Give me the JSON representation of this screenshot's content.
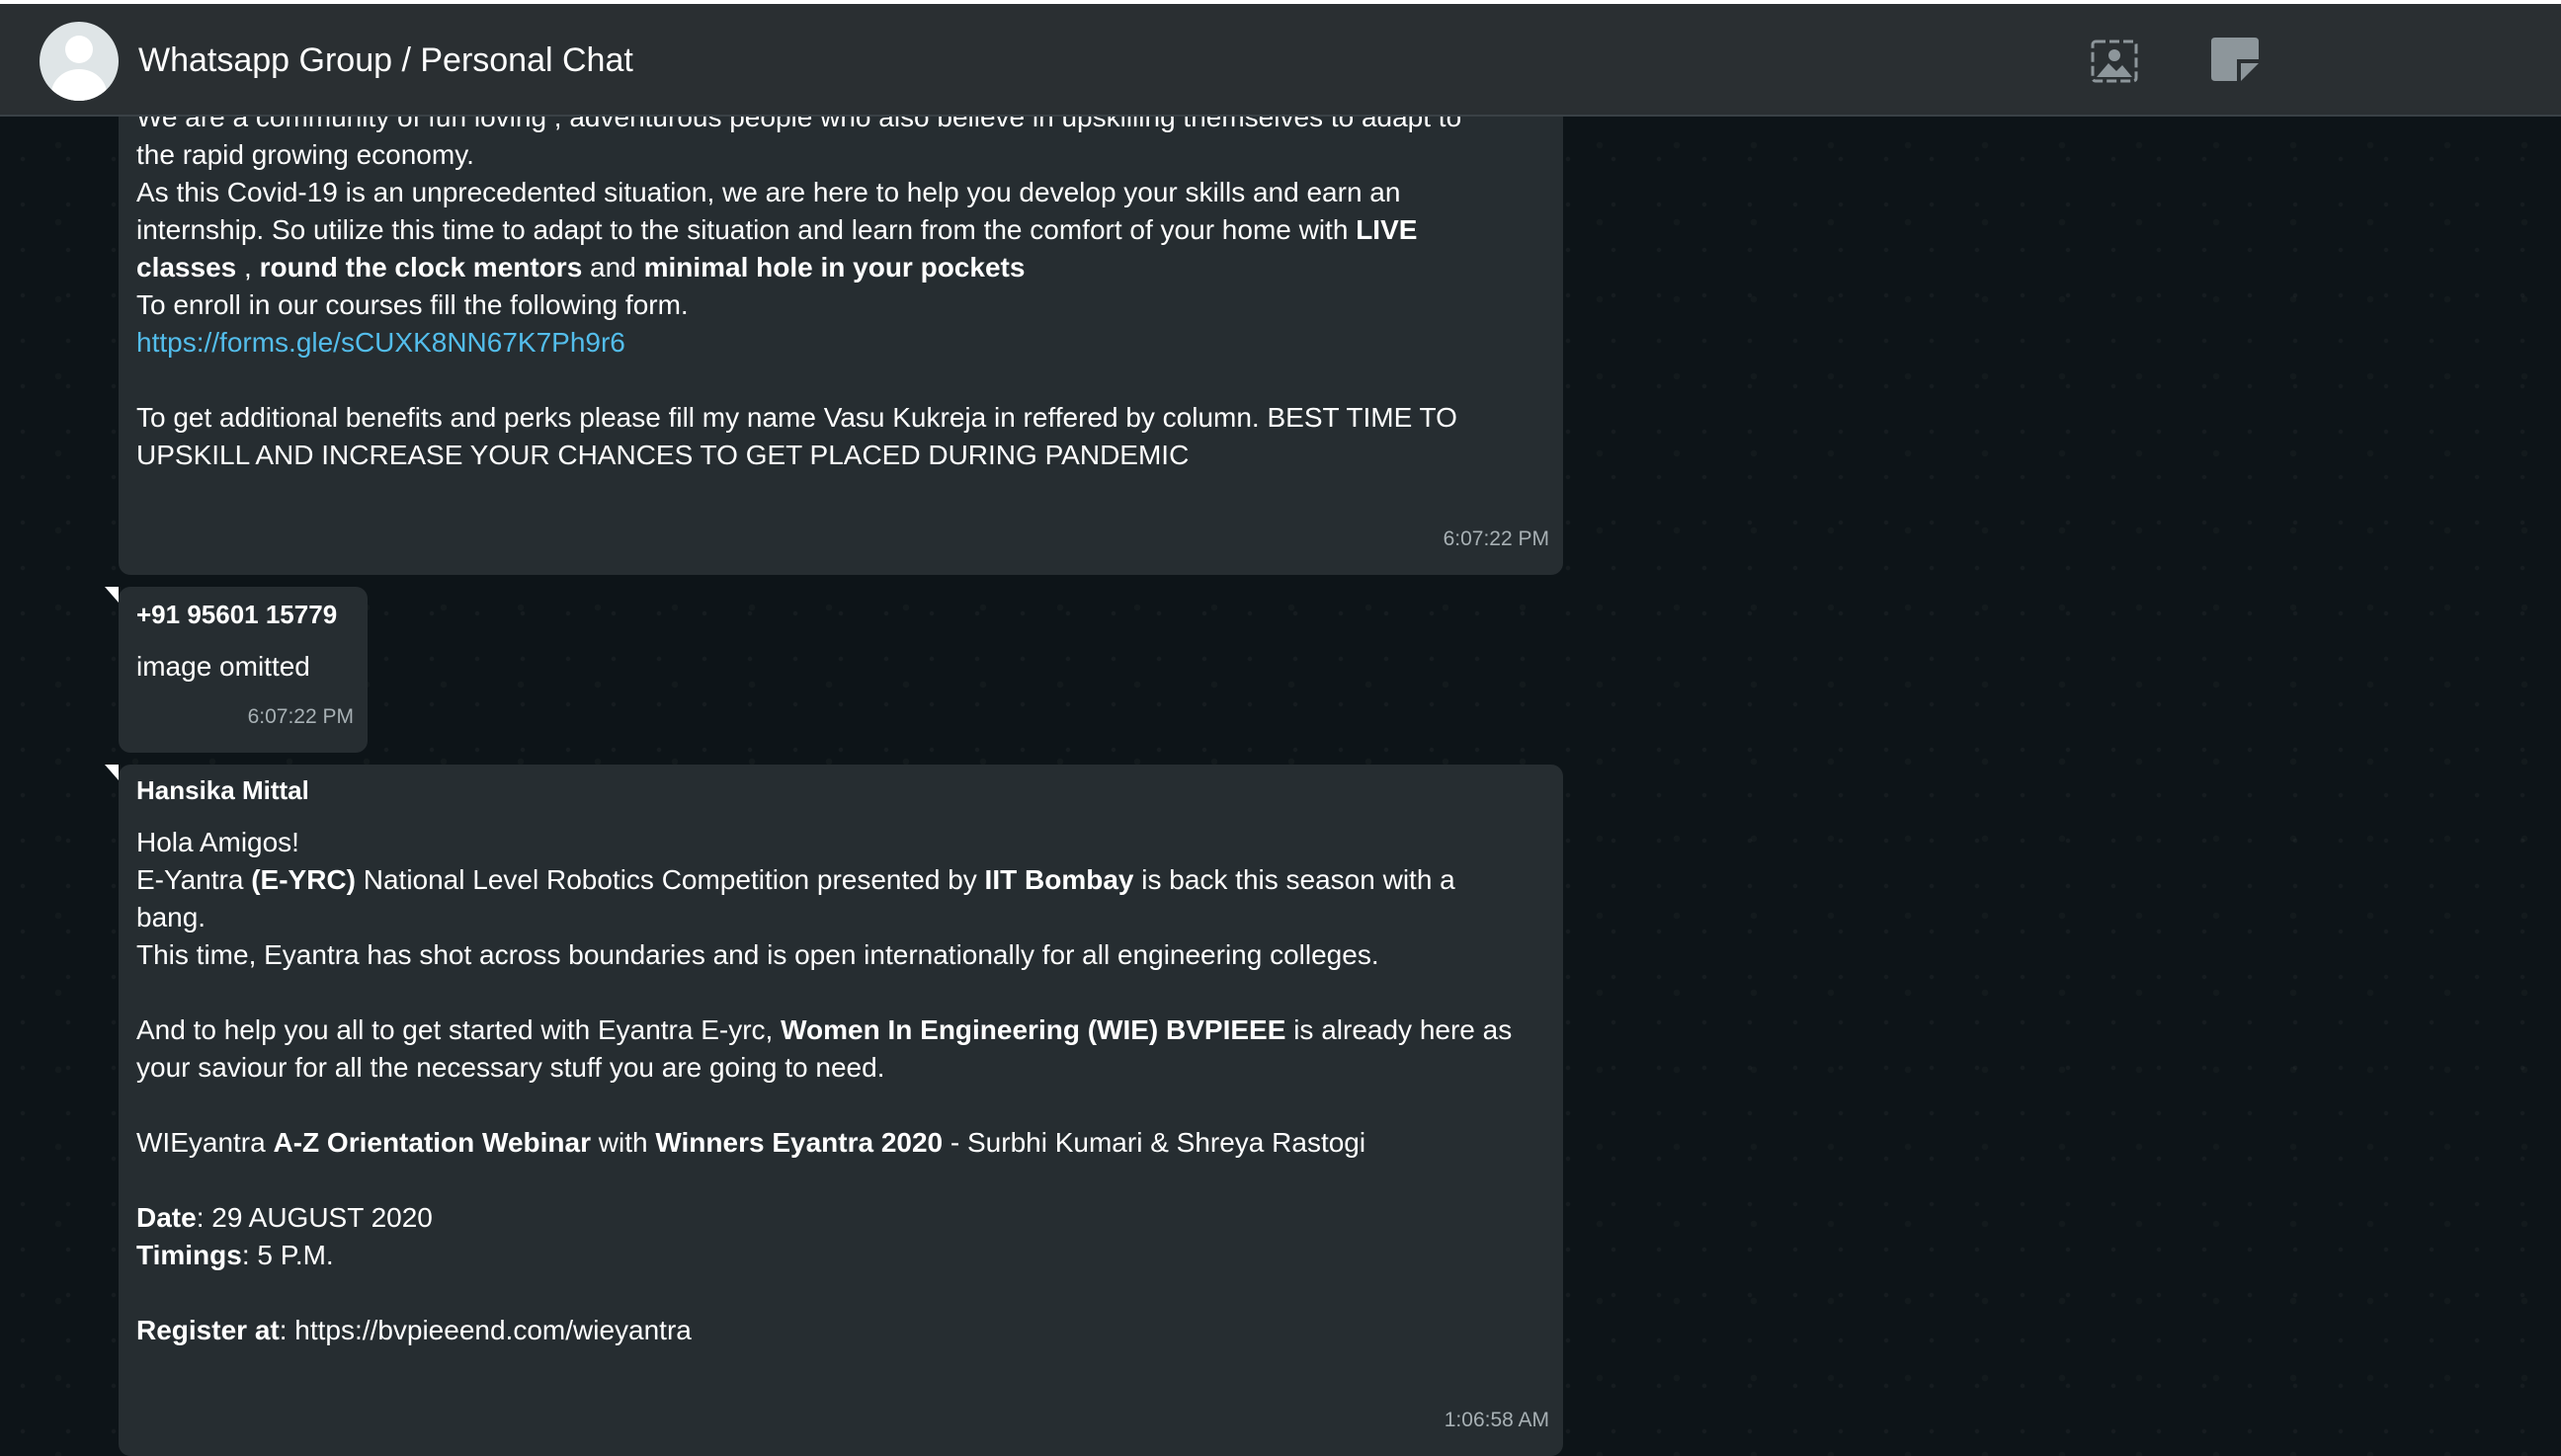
{
  "header": {
    "title": "Whatsapp Group / Personal Chat"
  },
  "messages": [
    {
      "lines": [
        "We are a community of fun loving , adventurous people who also believe in upskilling themselves to adapt to",
        "the rapid growing economy.",
        "As this Covid-19 is an unprecedented situation, we are here to help you develop your skills and earn an",
        "internship. So utilize this time to adapt to the situation and learn from the comfort of your home with ",
        "LIVE",
        "classes",
        " , ",
        "round the clock mentors",
        " and ",
        "minimal hole in your pockets",
        "To enroll in our courses fill the following form.",
        "https://forms.gle/sCUXK8NN67K7Ph9r6",
        "To get additional benefits and perks please fill my name Vasu Kukreja in reffered by column. BEST TIME TO",
        "UPSKILL AND INCREASE YOUR CHANCES TO GET PLACED DURING PANDEMIC"
      ],
      "time": "6:07:22 PM"
    },
    {
      "sender": "+91 95601 15779",
      "text": "image omitted",
      "time": "6:07:22 PM"
    },
    {
      "sender": "Hansika Mittal",
      "parts": [
        "Hola Amigos!",
        "E-Yantra ",
        "(E-YRC)",
        " National Level Robotics Competition presented by ",
        "IIT Bombay",
        " is back this season with a",
        "bang.",
        "This time, Eyantra has shot across boundaries and is open internationally for all engineering colleges.",
        "And to help you all to get started with Eyantra E-yrc, ",
        "Women In Engineering (WIE) BVPIEEE",
        " is already here as",
        "your saviour for all the necessary stuff you are going to need.",
        "WIEyantra ",
        "A-Z Orientation Webinar",
        " with ",
        "Winners Eyantra 2020",
        " - Surbhi Kumari & Shreya Rastogi",
        "Date",
        ": 29 AUGUST 2020",
        "Timings",
        ": 5 P.M.",
        "Register at",
        ": https://bvpieeend.com/wieyantra"
      ],
      "time": "1:06:58 AM"
    }
  ],
  "colors": {
    "header_bg": "#2a2f32",
    "bubble_bg": "#262d31",
    "chat_bg": "#0d1418",
    "link": "#53bdeb",
    "timestamp": "#a7b0b4"
  },
  "icons": {
    "header_left": "avatar-placeholder",
    "header_right_1": "image-search-icon",
    "header_right_2": "note-icon"
  }
}
